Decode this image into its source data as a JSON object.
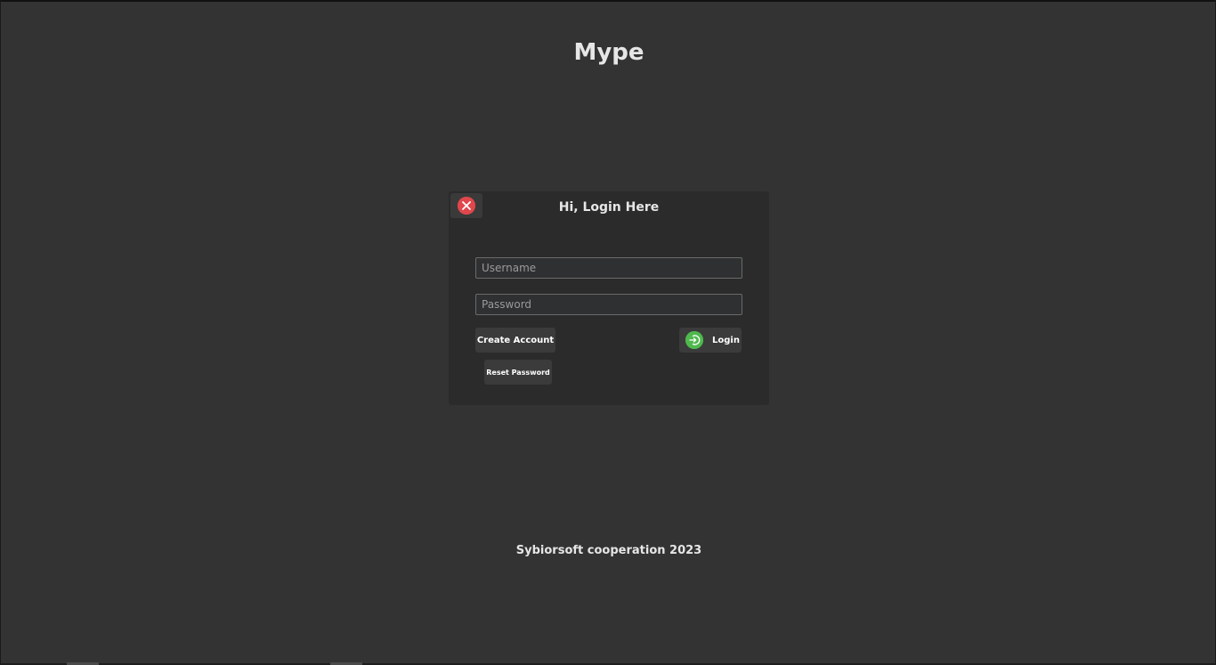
{
  "app": {
    "title": "Mype"
  },
  "login_panel": {
    "heading": "Hi, Login Here",
    "close_icon": "close-icon",
    "username": {
      "value": "",
      "placeholder": "Username"
    },
    "password": {
      "value": "",
      "placeholder": "Password"
    },
    "create_account_label": "Create Account",
    "login_label": "Login",
    "login_icon": "login-icon",
    "reset_password_label": "Reset Password"
  },
  "footer": {
    "text": "Sybiorsoft cooperation 2023"
  },
  "colors": {
    "background": "#333333",
    "panel": "#2b2b2b",
    "button": "#3b3b3b",
    "close_red": "#e0474c",
    "login_green": "#4fb94e",
    "text": "#e6e6e6"
  }
}
